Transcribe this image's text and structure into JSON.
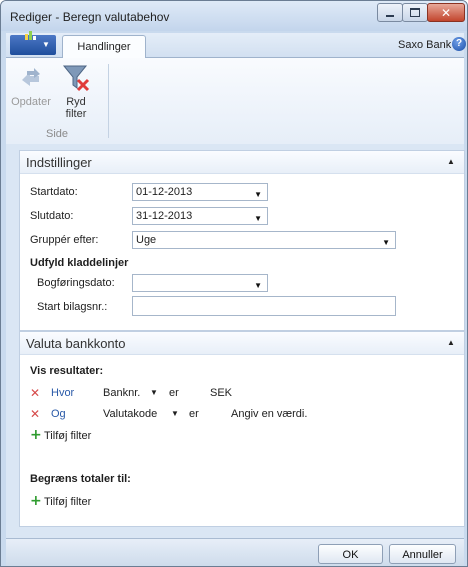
{
  "window": {
    "title": "Rediger - Beregn valutabehov"
  },
  "tabbar": {
    "tab_label": "Handlinger",
    "company": "Saxo Bank",
    "help_glyph": "?"
  },
  "ribbon": {
    "refresh_label": "Opdater",
    "clear_filter_line1": "Ryd",
    "clear_filter_line2": "filter",
    "group_label": "Side"
  },
  "settings": {
    "title": "Indstillinger",
    "start_label": "Startdato:",
    "start_value": "01-12-2013",
    "end_label": "Slutdato:",
    "end_value": "31-12-2013",
    "group_label": "Gruppér efter:",
    "group_value": "Uge",
    "section_label": "Udfyld kladdelinjer",
    "posting_label": "Bogføringsdato:",
    "posting_value": "",
    "doc_label": "Start bilagsnr.:",
    "doc_value": ""
  },
  "bank": {
    "title": "Valuta bankkonto",
    "results_label": "Vis resultater:",
    "filters": [
      {
        "conj": "Hvor",
        "field": "Banknr.",
        "op": "er",
        "value": "SEK"
      },
      {
        "conj": "Og",
        "field": "Valutakode",
        "op": "er",
        "value": "Angiv en værdi."
      }
    ],
    "add_filter": "Tilføj filter",
    "limit_label": "Begræns totaler til:",
    "add_filter2": "Tilføj filter"
  },
  "footer": {
    "ok": "OK",
    "cancel": "Annuller"
  },
  "colors": {
    "accent_blue": "#2a5aa8",
    "remove_red": "#d64a4a",
    "add_green": "#2f9c2f"
  }
}
